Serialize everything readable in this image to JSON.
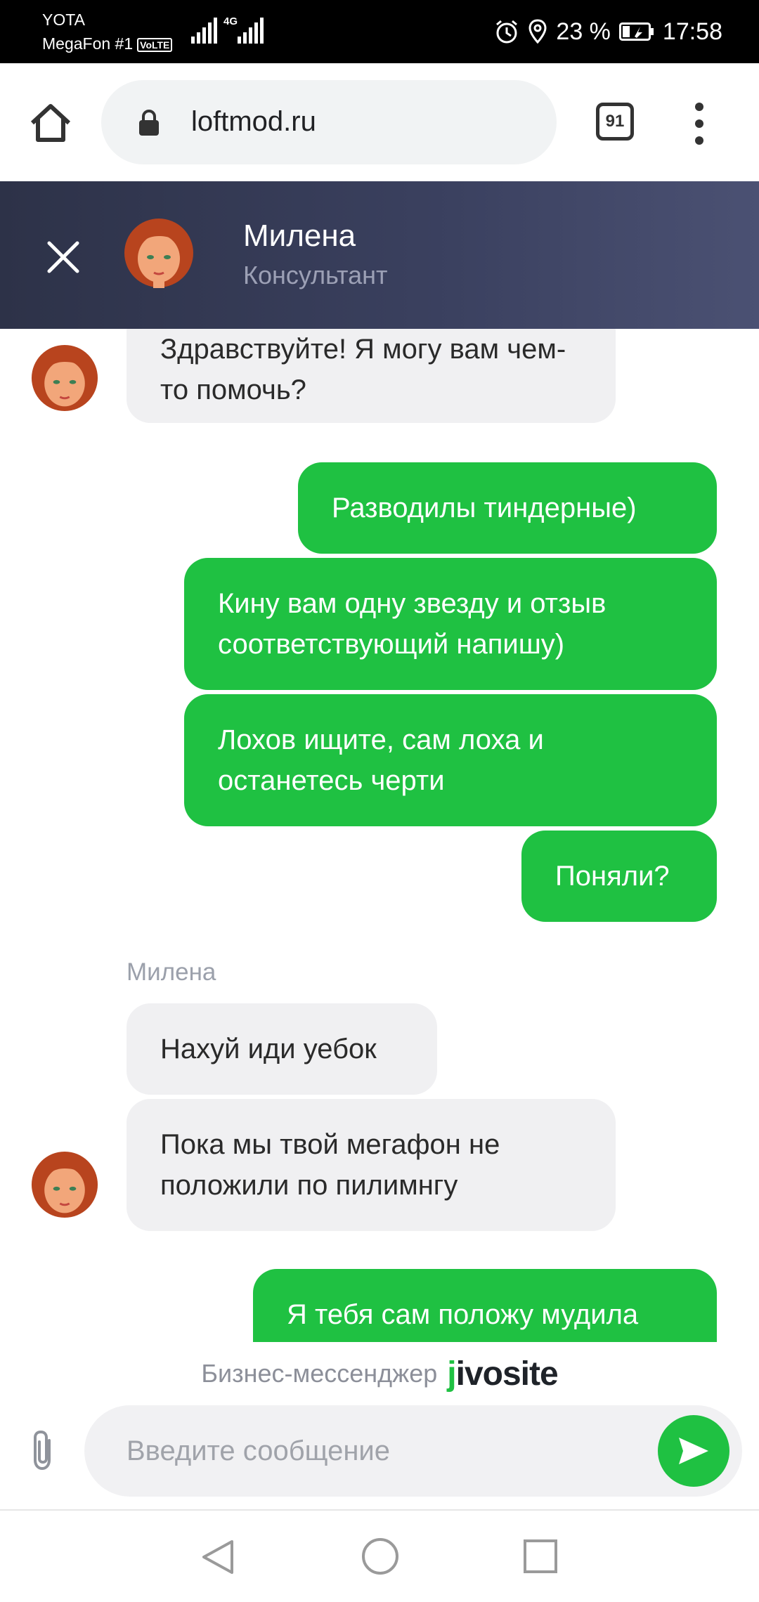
{
  "status_bar": {
    "carrier_1": "YOTA",
    "carrier_2": "MegaFon #1",
    "volte": "VoLTE",
    "network": "4G",
    "battery": "23 %",
    "time": "17:58",
    "icons": [
      "signal-icon",
      "alarm-icon",
      "location-icon",
      "battery-icon"
    ]
  },
  "browser": {
    "url": "loftmod.ru",
    "tab_count": "91",
    "icons": [
      "home-icon",
      "lock-icon",
      "tabs-icon",
      "more-vert-icon"
    ]
  },
  "chat_header": {
    "agent_name": "Милена",
    "agent_role": "Консультант"
  },
  "messages": [
    {
      "from": "agent",
      "text": "Здравствуйте! Я могу вам чем-то помочь?"
    },
    {
      "from": "user",
      "text": "Разводилы тиндерные)"
    },
    {
      "from": "user",
      "text": "Кину вам одну звезду и отзыв соответствующий напишу)"
    },
    {
      "from": "user",
      "text": "Лохов ищите, сам лоха и останетесь черти"
    },
    {
      "from": "user",
      "text": "Поняли?"
    },
    {
      "from": "agent",
      "text": "Нахуй иди уебок"
    },
    {
      "from": "agent",
      "text": "Пока мы твой мегафон не положили по пилимнгу"
    },
    {
      "from": "user",
      "text": "Я тебя сам положу мудила"
    }
  ],
  "sender_label": "Милена",
  "footer": {
    "powered_text": "Бизнес-мессенджер",
    "brand_j": "j",
    "brand_rest": "ivosite"
  },
  "composer": {
    "placeholder": "Введите сообщение"
  },
  "colors": {
    "accent_green": "#1fc142",
    "header_bg": "#33384f",
    "incoming_bubble": "#f0f0f2"
  }
}
